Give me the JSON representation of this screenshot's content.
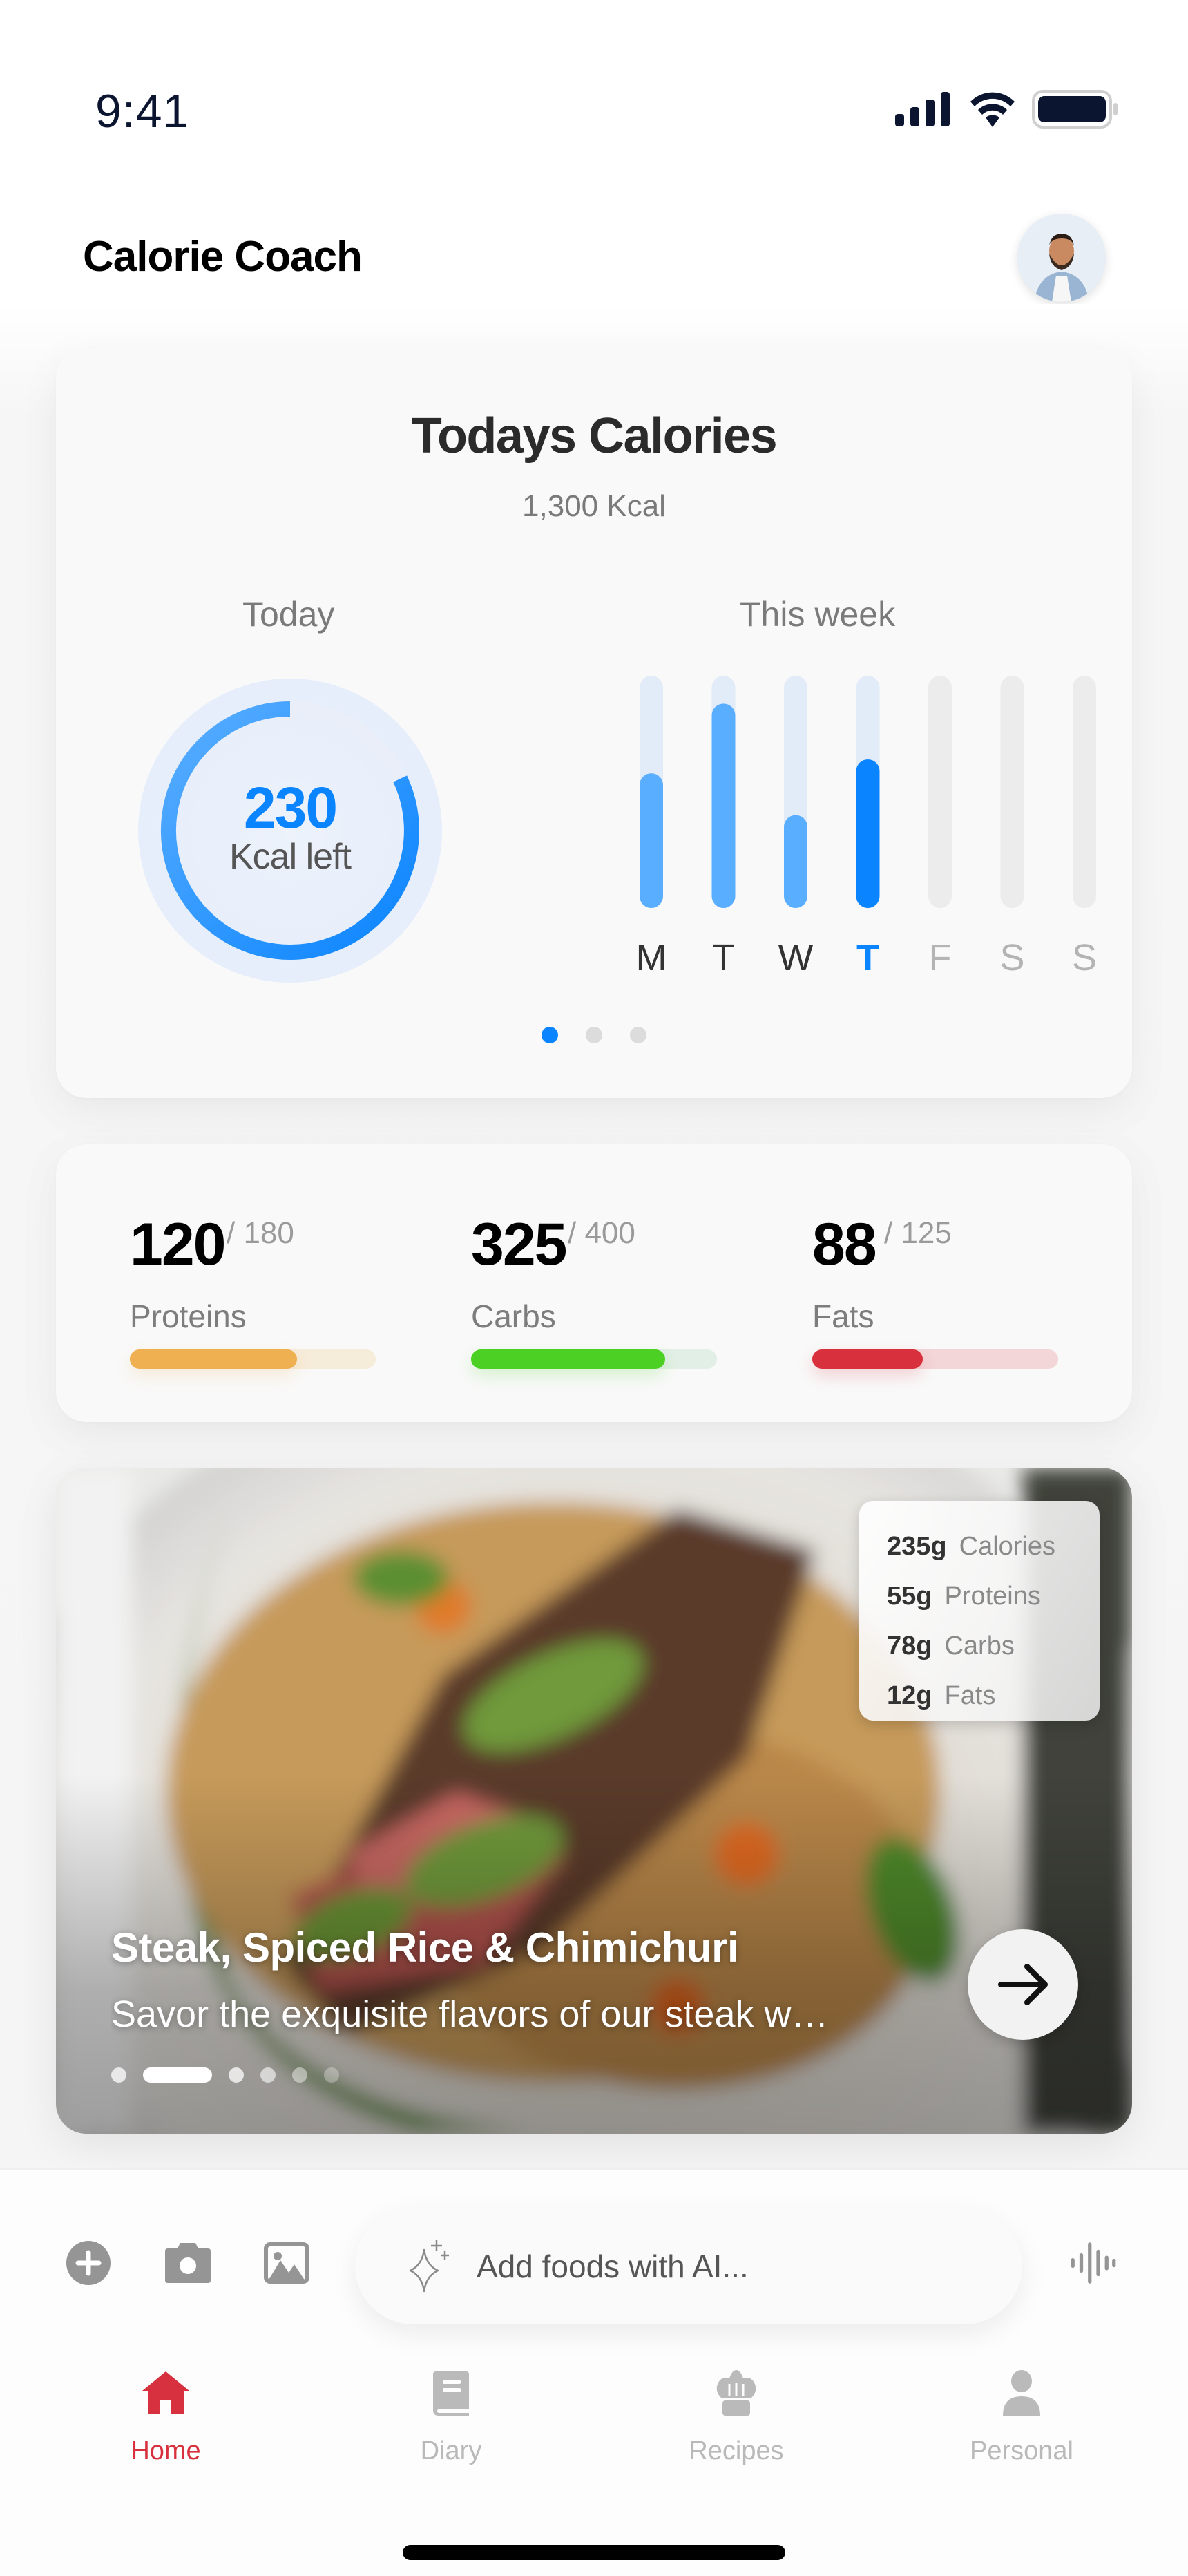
{
  "status_bar": {
    "time": "9:41",
    "icons": [
      "signal-icon",
      "wifi-icon",
      "battery-icon"
    ]
  },
  "header": {
    "title": "Calorie Coach",
    "avatar": "user-avatar"
  },
  "calories_card": {
    "title": "Todays Calories",
    "subtitle": "1,300 Kcal",
    "today_label": "Today",
    "week_label": "This week",
    "ring": {
      "value": "230",
      "label": "Kcal left",
      "progress": 0.82,
      "color": "#0A84FF"
    },
    "page_dots": {
      "count": 3,
      "active": 0
    }
  },
  "chart_data": {
    "type": "bar",
    "title": "This week",
    "categories": [
      "M",
      "T",
      "W",
      "T",
      "F",
      "S",
      "S"
    ],
    "values": [
      0.58,
      0.88,
      0.4,
      0.64,
      0,
      0,
      0
    ],
    "ylim": [
      0,
      1
    ],
    "highlight_index": 3,
    "xlabel": "",
    "ylabel": "",
    "colors": {
      "past": "#5AAEFF",
      "today": "#0A84FF",
      "track_active": "#E1ECF8",
      "track_future": "#ECECEC"
    }
  },
  "macros": [
    {
      "value": "120",
      "goal": "/ 180",
      "name": "Proteins",
      "progress": 0.68,
      "color": "#EEB050",
      "track": "#F6ECDA"
    },
    {
      "value": "325",
      "goal": "/ 400",
      "name": "Carbs",
      "progress": 0.79,
      "color": "#4CD024",
      "track": "#E2EFE6"
    },
    {
      "value": "88",
      "goal": "/ 125",
      "name": "Fats",
      "progress": 0.45,
      "color": "#D9303E",
      "track": "#F3D6D8"
    }
  ],
  "food_card": {
    "title": "Steak, Spiced Rice & Chimichuri",
    "description": "Savor the exquisite flavors of our steak w…",
    "nutrition": [
      {
        "amount": "235g",
        "name": "Calories"
      },
      {
        "amount": "55g",
        "name": "Proteins"
      },
      {
        "amount": "78g",
        "name": "Carbs"
      },
      {
        "amount": "12g",
        "name": "Fats"
      }
    ],
    "carousel": {
      "count": 6,
      "active": 1
    }
  },
  "input_bar": {
    "placeholder": "Add foods with AI...",
    "tools": [
      "add-icon",
      "camera-icon",
      "image-icon"
    ],
    "voice": "voice-waveform-icon"
  },
  "tabs": [
    {
      "label": "Home",
      "icon": "home-icon",
      "active": true
    },
    {
      "label": "Diary",
      "icon": "diary-book-icon",
      "active": false
    },
    {
      "label": "Recipes",
      "icon": "chef-hat-icon",
      "active": false
    },
    {
      "label": "Personal",
      "icon": "person-icon",
      "active": false
    }
  ],
  "accent_colors": {
    "primary": "#0A84FF",
    "tab_active": "#D7303E",
    "tab_inactive": "#B9B9B9"
  }
}
